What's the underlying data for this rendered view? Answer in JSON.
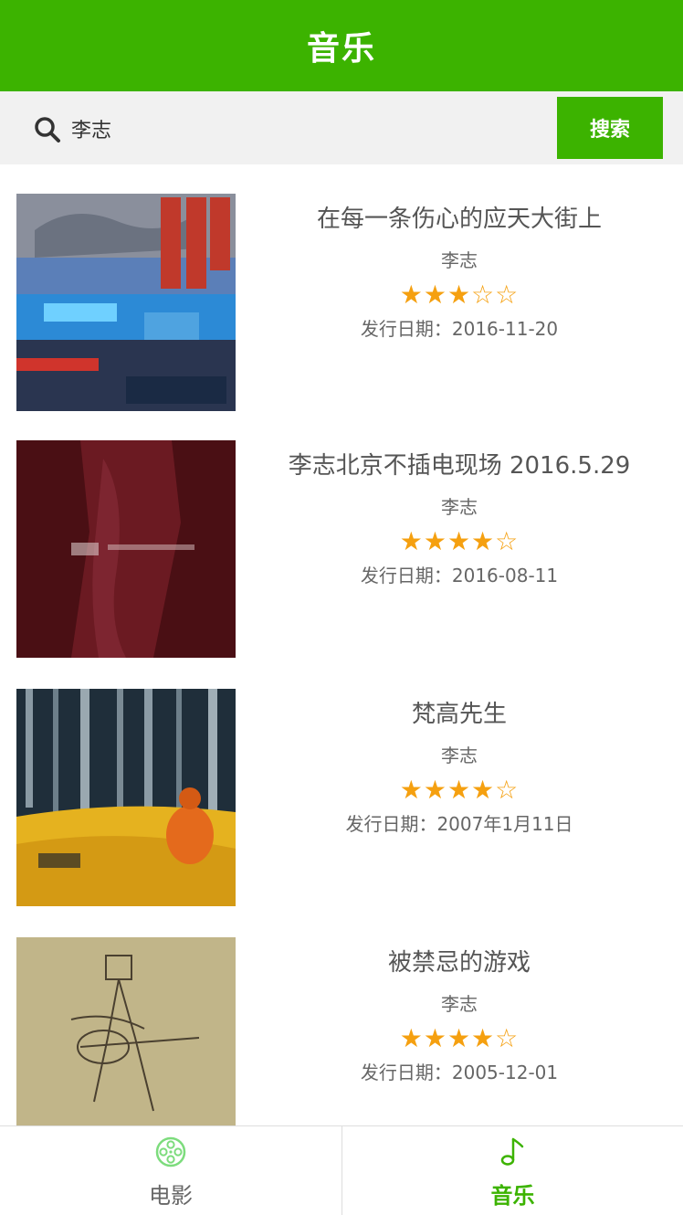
{
  "header": {
    "title": "音乐"
  },
  "search": {
    "value": "李志",
    "button_label": "搜索"
  },
  "albums": [
    {
      "title": "在每一条伤心的应天大街上",
      "artist": "李志",
      "stars": "★★★☆☆",
      "rating_stars": 3,
      "date": "发行日期：2016-11-20"
    },
    {
      "title": "李志北京不插电现场 2016.5.29",
      "artist": "李志",
      "stars": "★★★★☆",
      "rating_stars": 4,
      "date": "发行日期：2016-08-11"
    },
    {
      "title": "梵高先生",
      "artist": "李志",
      "stars": "★★★★☆",
      "rating_stars": 4,
      "date": "发行日期：2007年1月11日"
    },
    {
      "title": "被禁忌的游戏",
      "artist": "李志",
      "stars": "★★★★☆",
      "rating_stars": 4,
      "date": "发行日期：2005-12-01"
    }
  ],
  "tabs": [
    {
      "label": "电影",
      "icon": "film-reel-icon",
      "active": false
    },
    {
      "label": "音乐",
      "icon": "music-note-icon",
      "active": true
    }
  ],
  "colors": {
    "brand": "#3cb300",
    "star": "#f5a010"
  }
}
